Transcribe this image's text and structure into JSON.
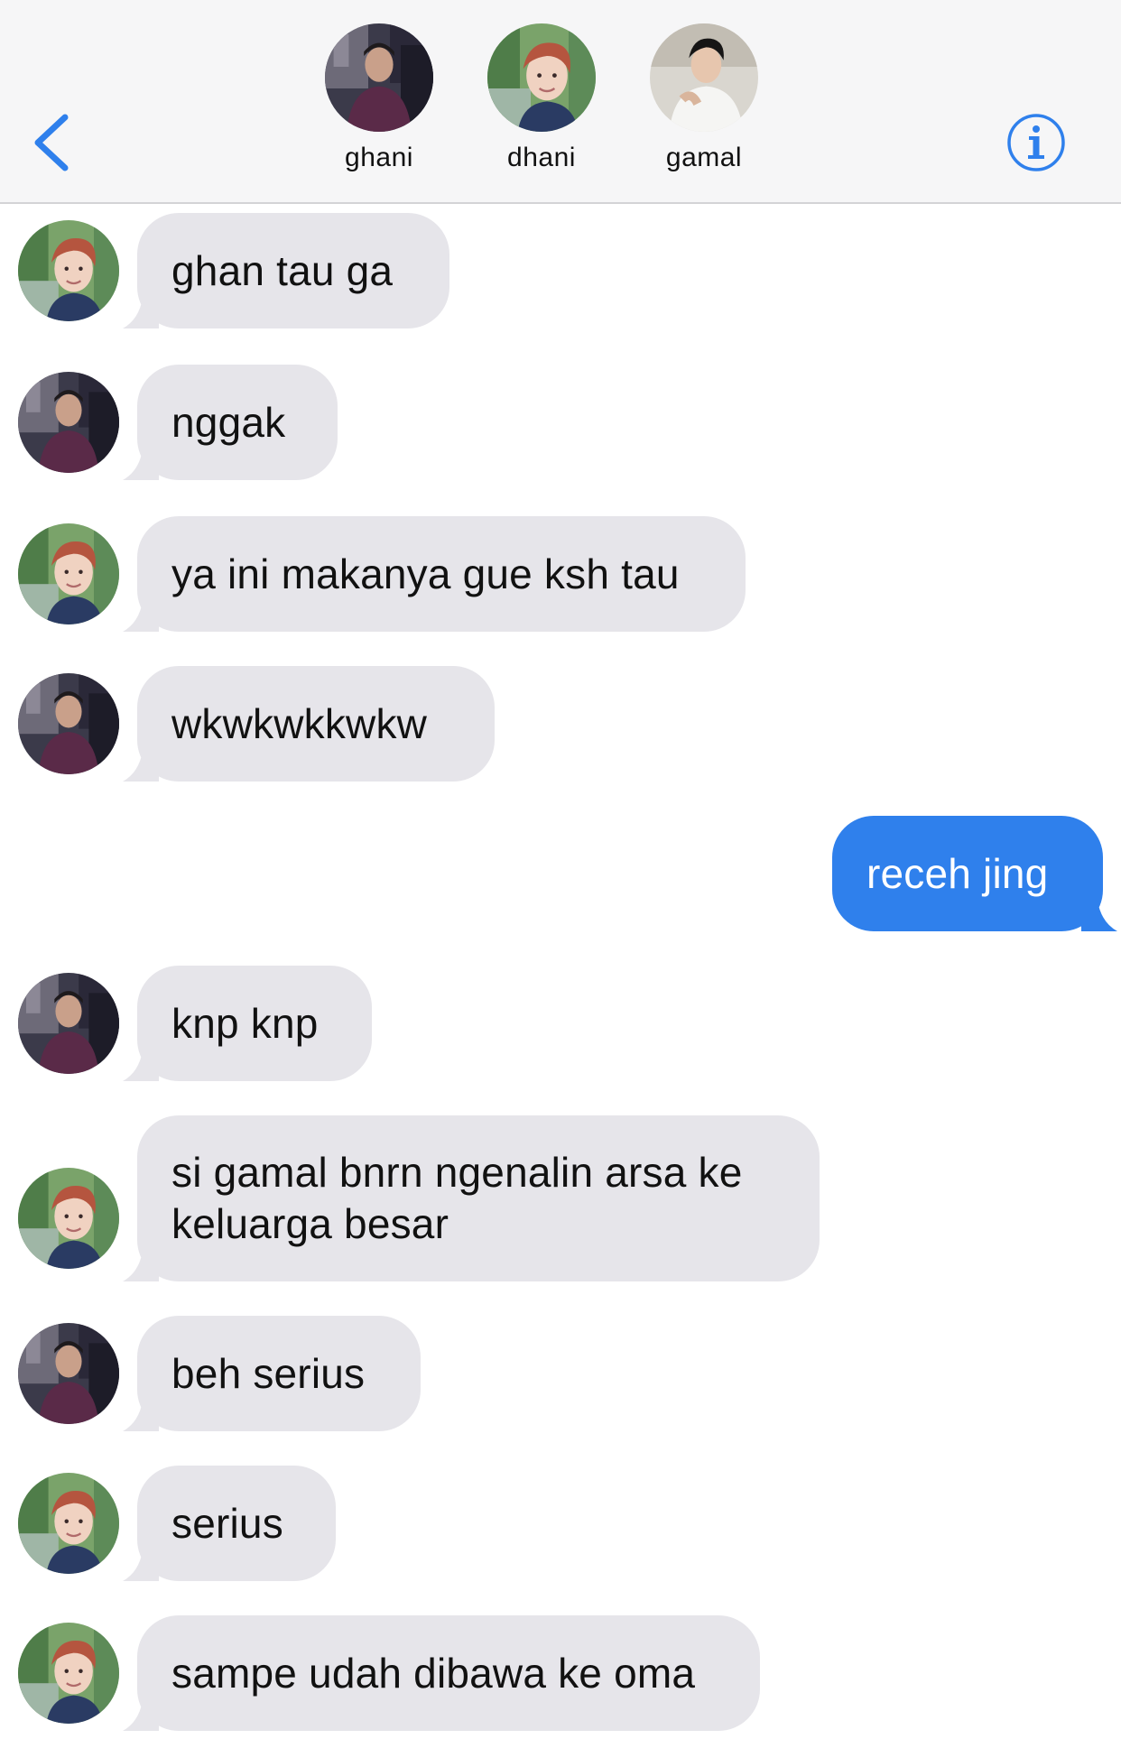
{
  "header": {
    "back_icon": "chevron-left-icon",
    "info_icon": "info-icon",
    "accent_color": "#2f80ec",
    "participants": [
      {
        "name": "ghani",
        "avatar": "person-photo-dark-outdoor"
      },
      {
        "name": "dhani",
        "avatar": "person-photo-red-hair"
      },
      {
        "name": "gamal",
        "avatar": "person-photo-white-shirt"
      }
    ]
  },
  "thread": {
    "incoming_bubble_color": "#e6e5ea",
    "outgoing_bubble_color": "#2f80ec",
    "messages": [
      {
        "sender": "dhani",
        "direction": "incoming",
        "text": "ghan tau ga"
      },
      {
        "sender": "ghani",
        "direction": "incoming",
        "text": "nggak"
      },
      {
        "sender": "dhani",
        "direction": "incoming",
        "text": "ya ini makanya gue ksh tau"
      },
      {
        "sender": "ghani",
        "direction": "incoming",
        "text": "wkwkwkkwkw"
      },
      {
        "sender": "me",
        "direction": "outgoing",
        "text": "receh jing"
      },
      {
        "sender": "ghani",
        "direction": "incoming",
        "text": "knp knp"
      },
      {
        "sender": "dhani",
        "direction": "incoming",
        "text": "si gamal bnrn ngenalin arsa ke keluarga besar"
      },
      {
        "sender": "ghani",
        "direction": "incoming",
        "text": "beh serius"
      },
      {
        "sender": "dhani",
        "direction": "incoming",
        "text": "serius"
      },
      {
        "sender": "dhani",
        "direction": "incoming",
        "text": "sampe udah dibawa ke oma"
      }
    ]
  }
}
